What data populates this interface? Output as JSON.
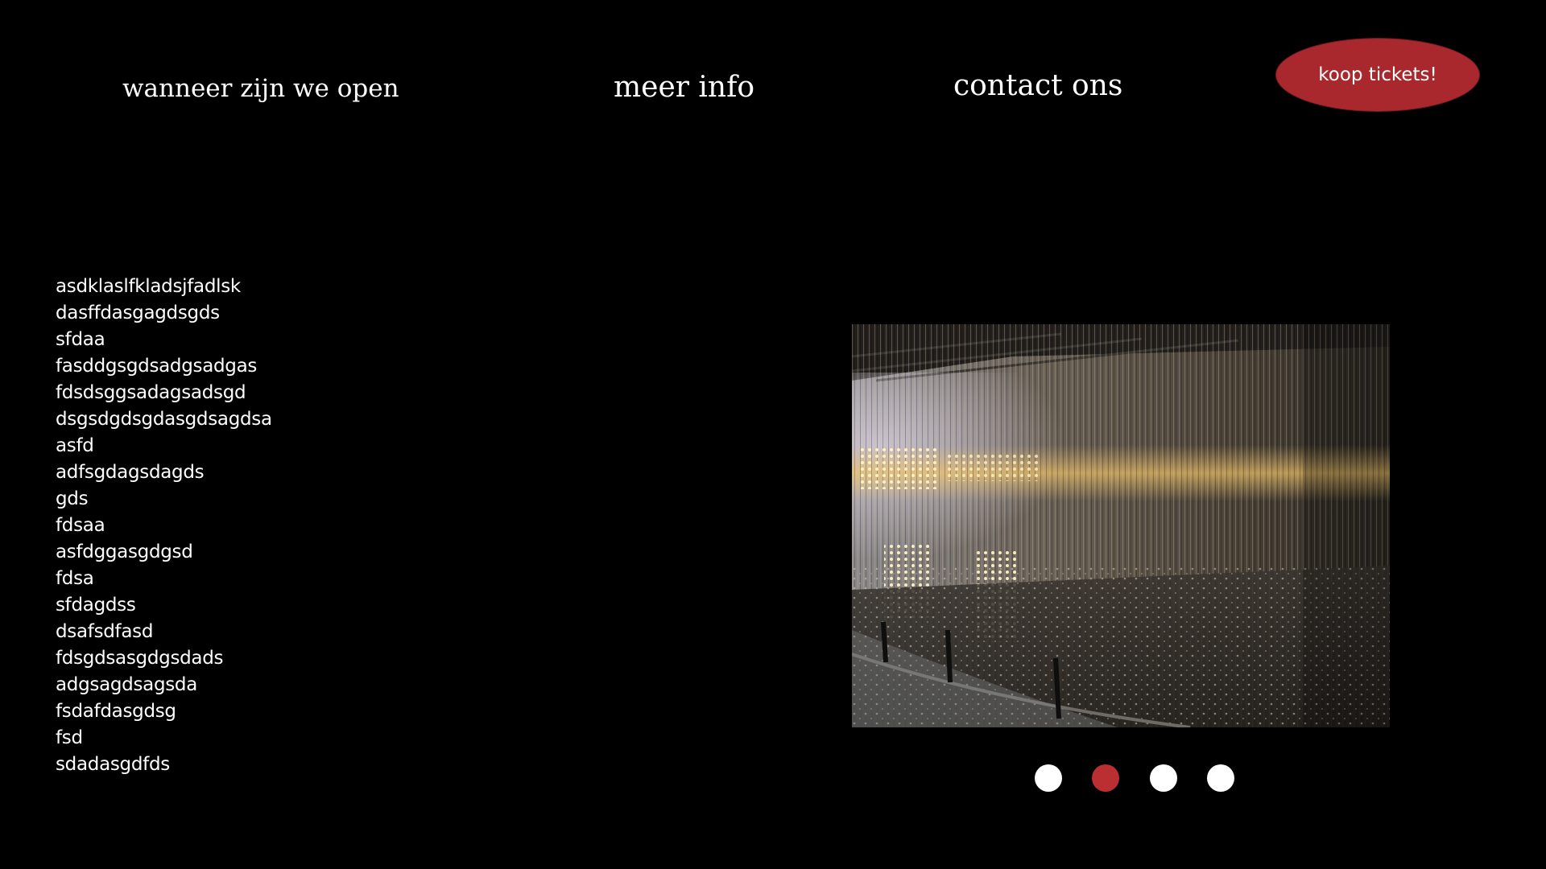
{
  "nav": {
    "links": [
      {
        "label": "wanneer zijn we open"
      },
      {
        "label": "meer info"
      },
      {
        "label": "contact ons"
      }
    ],
    "cta_label": "koop tickets!"
  },
  "content": {
    "lines": [
      "asdklaslfkladsjfadlsk",
      "dasffdasgagdsgds",
      "sfdaa",
      "fasddgsgdsadgsadgas",
      "fdsdsggsadagsadsgd",
      "dsgsdgdsgdasgdsagdsa",
      "asfd",
      "adfsgdagsdagds",
      "gds",
      "fdsaa",
      "asfdggasgdgsd",
      "fdsa",
      "sfdagdss",
      "dsafsdfasd",
      "fdsgdsasgdgsdads",
      "adgsagdsagsda",
      "fsdafdasgdsg",
      "fsd",
      "sdadasgdfds"
    ]
  },
  "slideshow": {
    "image_description_icon": "installation-photo",
    "active_index": 1,
    "count": 4
  },
  "colors": {
    "background": "#000000",
    "accent": "#a9282d",
    "active_dot": "#bb2f32",
    "text": "#ffffff"
  }
}
